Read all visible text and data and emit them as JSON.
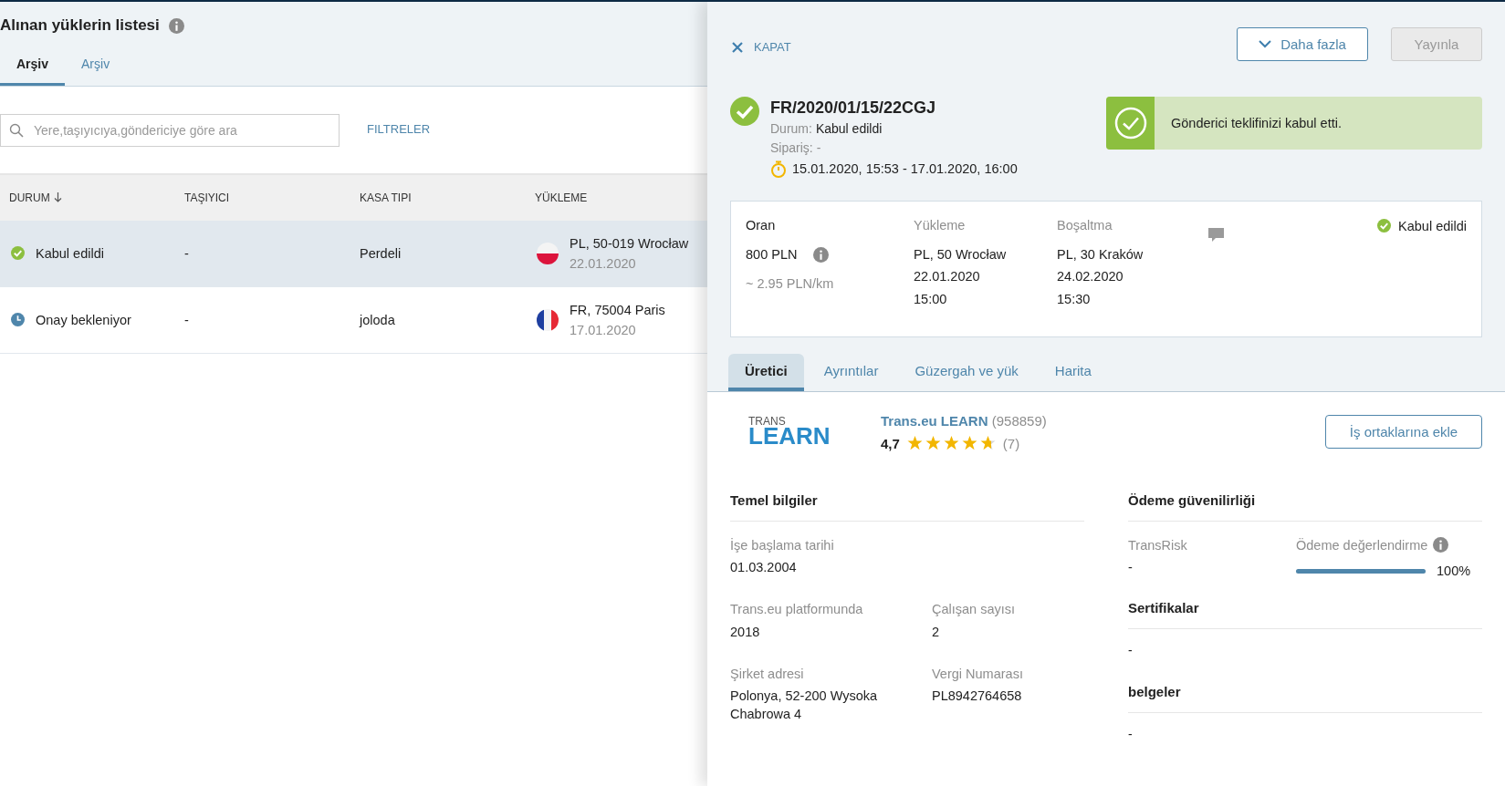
{
  "list": {
    "title": "Alınan yüklerin listesi",
    "tabs": [
      {
        "label": "Arşiv",
        "selected": true
      },
      {
        "label": "Arşiv",
        "selected": false
      }
    ],
    "search": {
      "placeholder": "Yere,taşıyıcıya,göndericiye göre ara"
    },
    "filters": "FILTRELER",
    "columns": [
      "DURUM",
      "TAŞIYICI",
      "KASA TIPI",
      "YÜKLEME"
    ],
    "rows": [
      {
        "status": {
          "kind": "accepted",
          "text": "Kabul edildi"
        },
        "carrier": "-",
        "body": "Perdeli",
        "loading": {
          "kind": "poland",
          "text": "PL, 50-019 Wrocław",
          "date": "22.01.2020"
        },
        "selected": true
      },
      {
        "status": {
          "kind": "pending",
          "text": "Onay bekleniyor"
        },
        "carrier": "-",
        "body": "joloda",
        "loading": {
          "kind": "france",
          "text": "FR, 75004 Paris",
          "date": "17.01.2020"
        },
        "selected": false
      }
    ]
  },
  "drawer": {
    "close": "KAPAT",
    "more": "Daha fazla",
    "publish": {
      "label": "Yayınla",
      "disabled": true
    },
    "id": "FR/2020/01/15/22CGJ",
    "status_label": "Durum:",
    "status": "Kabul edildi",
    "order_label": "Sipariş:",
    "order": "-",
    "period": "15.01.2020, 15:53 - 17.01.2020, 16:00",
    "notice": "Gönderici teklifinizi kabul etti.",
    "offer": {
      "rate_label": "Oran",
      "rate": "800  PLN",
      "per_km": "~ 2.95 PLN/km",
      "loading_label": "Yükleme",
      "loading": [
        "PL, 50 Wrocław",
        "22.01.2020",
        "15:00"
      ],
      "unloading_label": "Boşaltma",
      "unloading": [
        "PL, 30 Kraków",
        "24.02.2020",
        "15:30"
      ],
      "status": "Kabul edildi"
    },
    "tabs": [
      {
        "label": "Üretici",
        "selected": true
      },
      {
        "label": "Ayrıntılar",
        "selected": false
      },
      {
        "label": "Güzergah ve yük",
        "selected": false
      },
      {
        "label": "Harita",
        "selected": false
      }
    ],
    "company": {
      "logo_small": "TRANS",
      "logo_big": "LEARN",
      "name": "Trans.eu LEARN",
      "number": "(958859)",
      "rating": "4,7",
      "stars": 4.7,
      "reviews": "(7)",
      "add_button": "İş ortaklarına ekle"
    },
    "basic": {
      "title": "Temel bilgiler",
      "fields": [
        {
          "label": "İşe başlama tarihi",
          "value": "01.03.2004"
        },
        {
          "label": "Trans.eu platformunda",
          "value": "2018"
        },
        {
          "label": "Çalışan sayısı",
          "value": "2"
        },
        {
          "label": "Şirket adresi",
          "value": "Polonya, 52-200 Wysoka Chabrowa 4"
        },
        {
          "label": "Vergi Numarası",
          "value": "PL8942764658"
        }
      ]
    },
    "payment": {
      "title": "Ödeme güvenilirliği",
      "transrisk_label": "TransRisk",
      "transrisk": "-",
      "rating_label": "Ödeme değerlendirme",
      "level": 1.0,
      "percent": "100%"
    },
    "certificates": {
      "title": "Sertifikalar",
      "value": "-"
    },
    "documents": {
      "title": "belgeler",
      "value": "-"
    }
  }
}
